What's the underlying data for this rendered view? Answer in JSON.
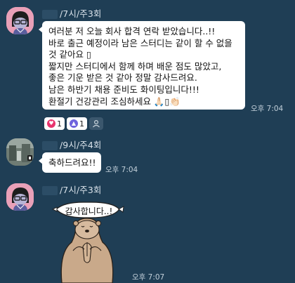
{
  "messages": [
    {
      "sender": "/7시/주3회",
      "lines": [
        "여러분 저 오늘 회사 합격 연락 받았습니다..!!",
        "바로 출근 예정이라 남은 스터디는 같이 할 수 없을",
        " 것 같아요 ▯",
        "짧지만 스터디에서 함께 하며 배운 점도 많았고,",
        "좋은 기운 받은 것 같아 정말 감사드려요.",
        "남은 하반기 채용 준비도 화이팅입니다!!!",
        "환절기 건강관리 조심하세요 🙏🏻▯👏🏻"
      ],
      "time": "오후 7:04",
      "reactions": [
        {
          "type": "heart-icon",
          "count": "1"
        },
        {
          "type": "thumbs-up-icon",
          "count": "1"
        }
      ]
    },
    {
      "sender": "/9시/주4회",
      "text": "축하드려요!!",
      "time": "오후 7:04"
    },
    {
      "sender": "/7시/주3회",
      "sticker_text": "감사합니다..!",
      "time": "오후 7:07"
    }
  ],
  "colors": {
    "background": "#1f3e55",
    "bubble": "#ffffff",
    "heart": "#e8336d",
    "thumb": "#6f63dd"
  }
}
